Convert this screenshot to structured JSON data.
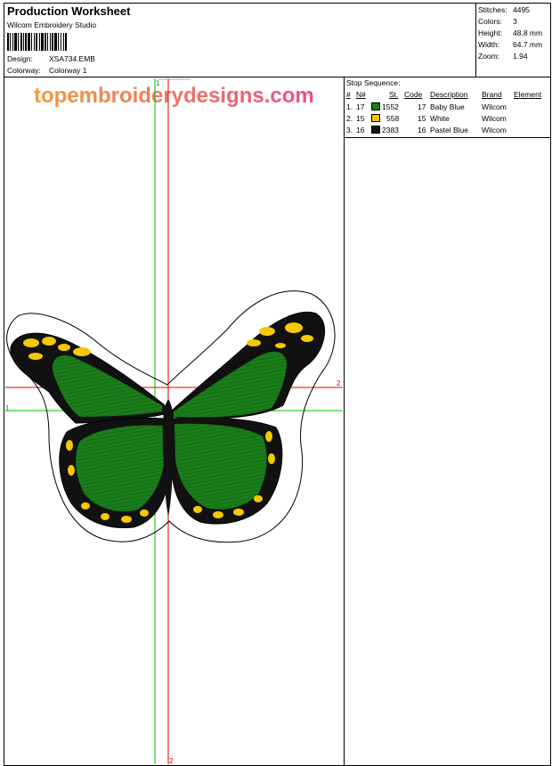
{
  "header": {
    "title": "Production Worksheet",
    "software": "Wilcom  Embroidery Studio",
    "design_label": "Design:",
    "design_value": "XSA734.EMB",
    "colorway_label": "Colorway:",
    "colorway_value": "Colorway 1"
  },
  "stats": [
    {
      "label": "Stitches:",
      "value": "4495"
    },
    {
      "label": "Colors:",
      "value": "3"
    },
    {
      "label": "Height:",
      "value": "48.8 mm"
    },
    {
      "label": "Width:",
      "value": "64.7 mm"
    },
    {
      "label": "Zoom:",
      "value": "1.94"
    }
  ],
  "watermark": "topembroiderydesigns.com",
  "stop_sequence": {
    "title": "Stop Sequence:",
    "headers": {
      "num": "#",
      "n": "N#",
      "st": "St.",
      "code": "Code",
      "description": "Description",
      "brand": "Brand",
      "element": "Element"
    },
    "rows": [
      {
        "num": "1.",
        "n": "17",
        "color": "#1a7d1a",
        "st": "1552",
        "code": "17",
        "description": "Baby  Blue",
        "brand": "Wilcom"
      },
      {
        "num": "2.",
        "n": "15",
        "color": "#f5c800",
        "st": "558",
        "code": "15",
        "description": "White",
        "brand": "Wilcom"
      },
      {
        "num": "3.",
        "n": "16",
        "color": "#111111",
        "st": "2383",
        "code": "16",
        "description": "Pastel Blue",
        "brand": "Wilcom"
      }
    ]
  },
  "axis_markers": {
    "v1": "1",
    "h1": "1",
    "h2": "2",
    "v2": "2"
  },
  "colors": {
    "green": "#1a7d1a",
    "yellow": "#f5c800",
    "black": "#111111",
    "guide_green": "#00c000",
    "guide_red": "#e00000",
    "watermark_orange": "#f39a3c",
    "watermark_pink": "#ea4f8d"
  }
}
